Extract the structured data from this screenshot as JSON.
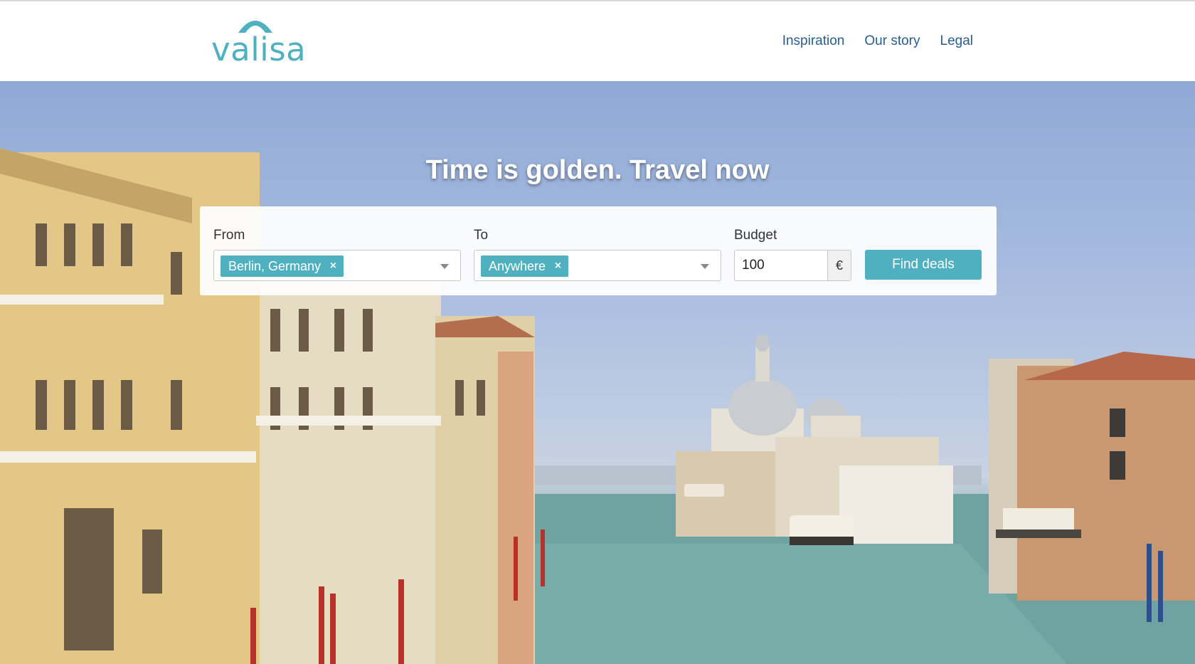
{
  "brand": {
    "name": "valisa",
    "color": "#4fb0c0"
  },
  "nav": {
    "items": [
      "Inspiration",
      "Our story",
      "Legal"
    ]
  },
  "hero": {
    "headline": "Time is golden. Travel now",
    "image_subject": "venice-grand-canal-photo"
  },
  "search": {
    "from": {
      "label": "From",
      "value": "Berlin, Germany",
      "remove_glyph": "×"
    },
    "to": {
      "label": "To",
      "value": "Anywhere",
      "remove_glyph": "×"
    },
    "budget": {
      "label": "Budget",
      "value": "100",
      "currency": "€"
    },
    "submit_label": "Find deals"
  },
  "colors": {
    "accent": "#4fb0c0",
    "nav_link": "#2a5d8f"
  }
}
